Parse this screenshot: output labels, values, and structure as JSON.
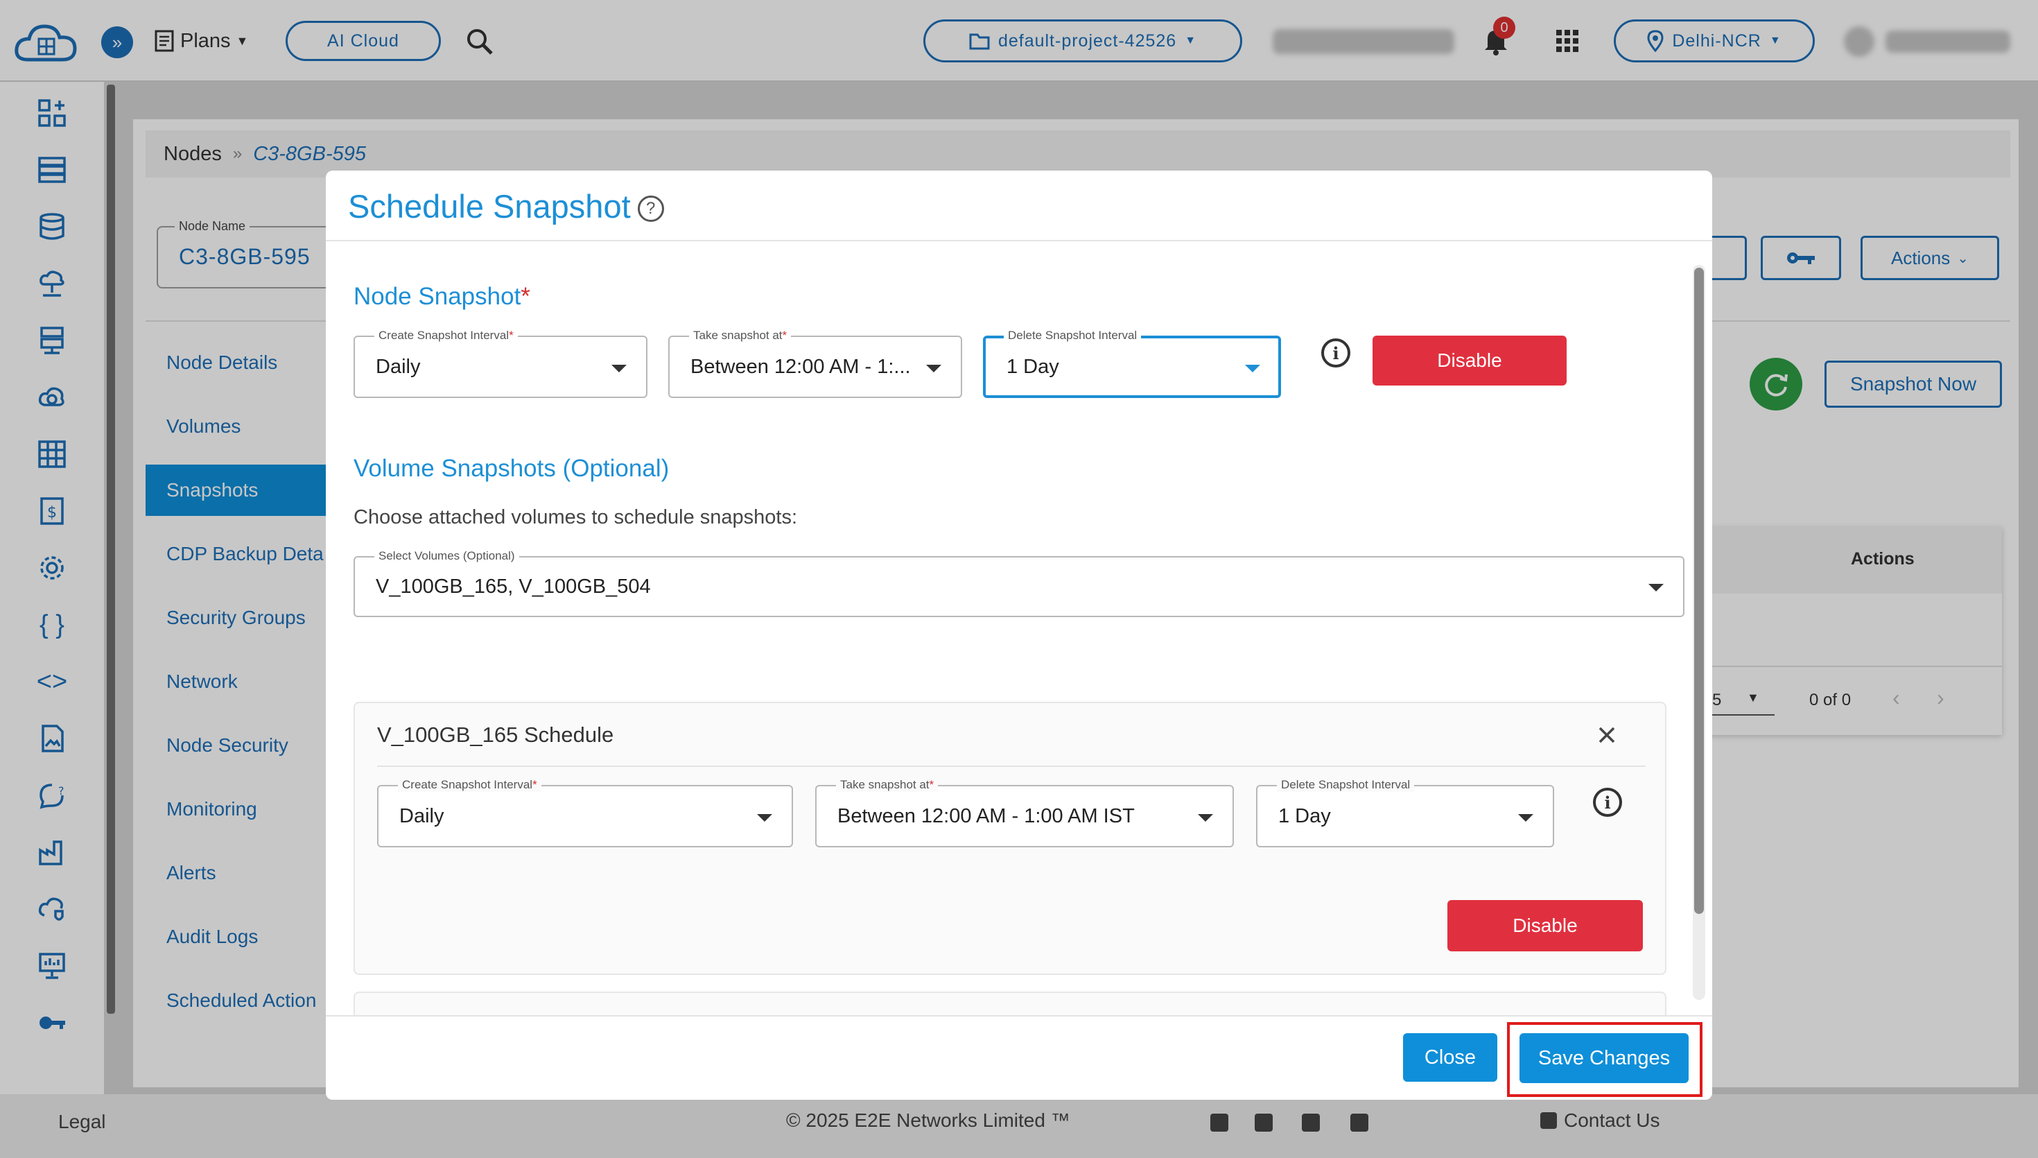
{
  "topbar": {
    "plans_label": "Plans",
    "ai_cloud_label": "AI Cloud",
    "project_label": "default-project-42526",
    "notification_count": "0",
    "region_label": "Delhi-NCR"
  },
  "breadcrumb": {
    "root": "Nodes",
    "separator": "»",
    "current": "C3-8GB-595"
  },
  "node": {
    "name_label": "Node Name",
    "name_value": "C3-8GB-595"
  },
  "page_actions": {
    "actions_label": "Actions",
    "snapshot_now_label": "Snapshot Now",
    "table_actions_header": "Actions",
    "per_page": "5",
    "pagination_text": "0 of 0"
  },
  "left_nav": [
    {
      "label": "Node Details"
    },
    {
      "label": "Volumes"
    },
    {
      "label": "Snapshots"
    },
    {
      "label": "CDP Backup Deta"
    },
    {
      "label": "Security Groups"
    },
    {
      "label": "Network"
    },
    {
      "label": "Node Security"
    },
    {
      "label": "Monitoring"
    },
    {
      "label": "Alerts"
    },
    {
      "label": "Audit Logs"
    },
    {
      "label": "Scheduled Action"
    }
  ],
  "modal": {
    "title": "Schedule Snapshot",
    "help_glyph": "?",
    "node_snapshot": {
      "title": "Node Snapshot",
      "required_mark": "*",
      "create_interval": {
        "label": "Create Snapshot Interval",
        "value": "Daily"
      },
      "take_at": {
        "label": "Take snapshot at",
        "value": "Between 12:00 AM - 1:..."
      },
      "delete_interval": {
        "label": "Delete Snapshot Interval",
        "value": "1 Day"
      },
      "disable_label": "Disable"
    },
    "volume_snapshots": {
      "title": "Volume Snapshots (Optional)",
      "instruction": "Choose attached volumes to schedule snapshots:",
      "select_label": "Select Volumes (Optional)",
      "select_value": "V_100GB_165, V_100GB_504"
    },
    "volume_schedule": {
      "title": "V_100GB_165 Schedule",
      "create_interval": {
        "label": "Create Snapshot Interval",
        "value": "Daily"
      },
      "take_at": {
        "label": "Take snapshot at",
        "value": "Between 12:00 AM - 1:00 AM IST"
      },
      "delete_interval": {
        "label": "Delete Snapshot Interval",
        "value": "1 Day"
      },
      "disable_label": "Disable"
    },
    "footer": {
      "close_label": "Close",
      "save_label": "Save Changes"
    }
  },
  "footer": {
    "legal": "Legal",
    "copyright": "© 2025 E2E Networks Limited ™",
    "contact": "Contact Us"
  },
  "colors": {
    "accent": "#1d8fd6",
    "danger": "#e0303f",
    "primary_button": "#0f8fd9",
    "highlight_box": "#e01b1b",
    "refresh_green": "#2e9e46"
  }
}
